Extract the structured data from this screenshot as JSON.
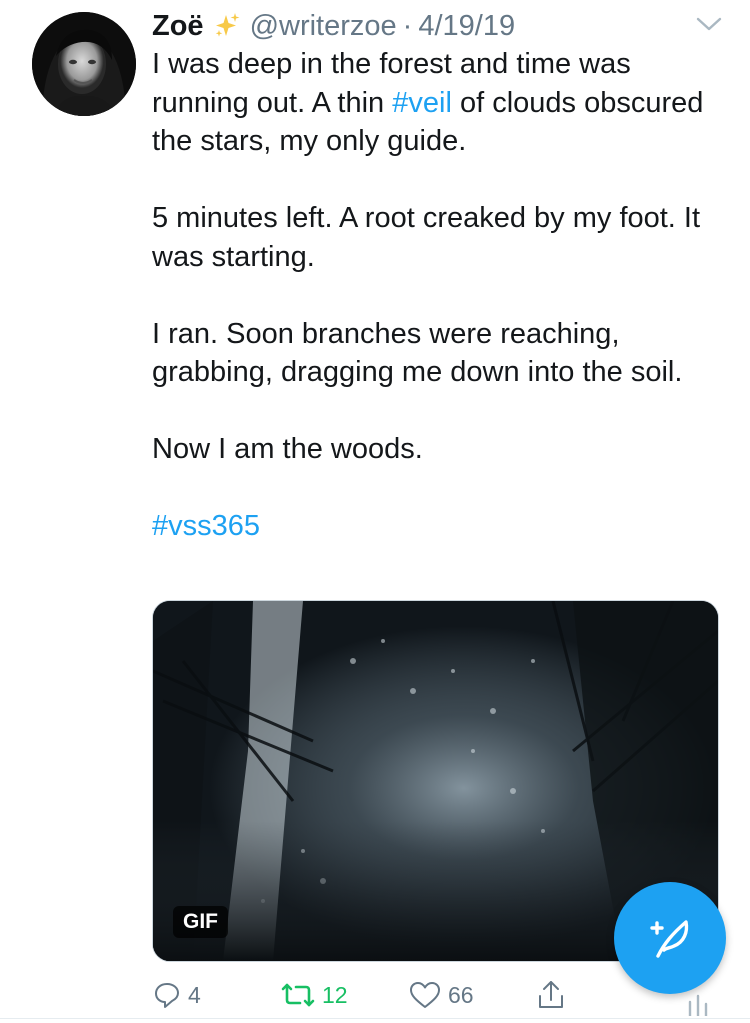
{
  "tweet": {
    "author_name": "Zoë",
    "author_emoji_icon": "sparkles-icon",
    "handle": "@writerzoe",
    "separator": "·",
    "date": "4/19/19",
    "paragraphs": {
      "p1_before": "I was deep in the forest and time was running out. A thin ",
      "p1_link": "#veil",
      "p1_after": " of clouds obscured the stars, my only guide.",
      "p2": "5 minutes left. A root creaked by my foot. It was starting.",
      "p3": "I ran. Soon branches were reaching, grabbing, dragging me down into the soil.",
      "p4": "Now I am the woods.",
      "p5_link": "#vss365"
    },
    "media": {
      "badge": "GIF"
    },
    "actions": {
      "reply_count": "4",
      "retweet_count": "12",
      "like_count": "66"
    }
  },
  "colors": {
    "link": "#1da1f2",
    "retweet_active": "#17bf63",
    "secondary_text": "#657786",
    "fab": "#1da1f2"
  }
}
